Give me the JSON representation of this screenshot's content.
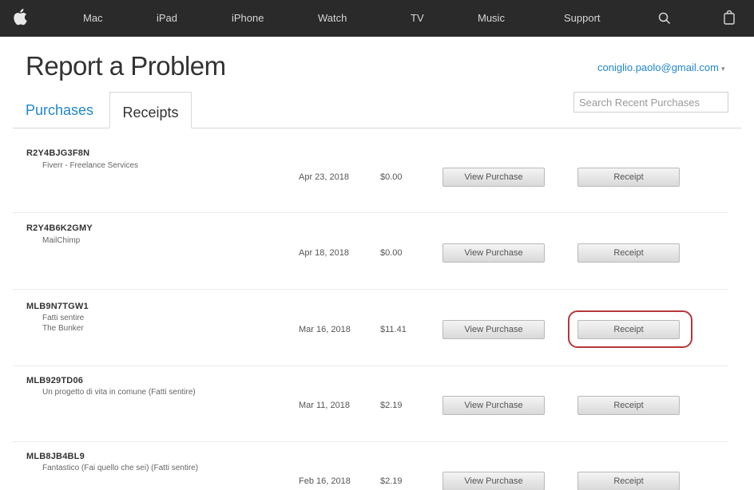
{
  "nav": {
    "items": [
      "Mac",
      "iPad",
      "iPhone",
      "Watch",
      "TV",
      "Music",
      "Support"
    ],
    "icons": [
      "apple-logo-icon",
      "search-icon",
      "bag-icon"
    ]
  },
  "header": {
    "title": "Report a Problem",
    "account": "coniglio.paolo@gmail.com",
    "account_caret": "▾"
  },
  "tabs": {
    "purchases": "Purchases",
    "receipts": "Receipts"
  },
  "search": {
    "placeholder": "Search Recent Purchases"
  },
  "rows": [
    {
      "order_id": "R2Y4BJG3F8N",
      "items": [
        "Fiverr - Freelance Services"
      ],
      "date": "Apr 23, 2018",
      "price": "$0.00",
      "view_label": "View Purchase",
      "receipt_label": "Receipt"
    },
    {
      "order_id": "R2Y4B6K2GMY",
      "items": [
        "MailChimp"
      ],
      "date": "Apr 18, 2018",
      "price": "$0.00",
      "view_label": "View Purchase",
      "receipt_label": "Receipt"
    },
    {
      "order_id": "MLB9N7TGW1",
      "items": [
        "Fatti sentire",
        "The Bunker"
      ],
      "date": "Mar 16, 2018",
      "price": "$11.41",
      "view_label": "View Purchase",
      "receipt_label": "Receipt"
    },
    {
      "order_id": "MLB929TD06",
      "items": [
        "Un progetto di vita in comune (Fatti sentire)"
      ],
      "date": "Mar 11, 2018",
      "price": "$2.19",
      "view_label": "View Purchase",
      "receipt_label": "Receipt"
    },
    {
      "order_id": "MLB8JB4BL9",
      "items": [
        "Fantastico (Fai quello che sei) (Fatti sentire)"
      ],
      "date": "Feb 16, 2018",
      "price": "$2.19",
      "view_label": "View Purchase",
      "receipt_label": "Receipt"
    }
  ],
  "colors": {
    "nav_bg": "#2a2a2a",
    "link": "#2187c9",
    "highlight": "#b5383a"
  }
}
